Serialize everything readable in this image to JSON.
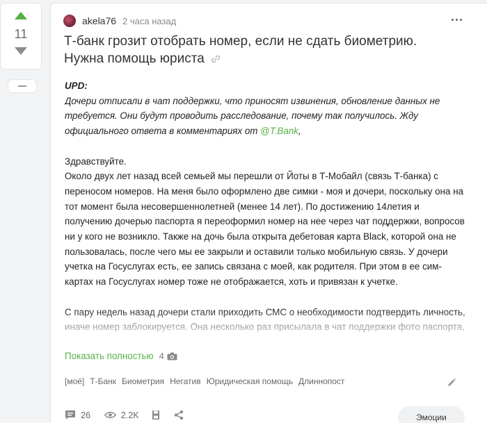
{
  "vote": {
    "count": "11"
  },
  "post": {
    "author": "akela76",
    "time": "2 часа назад",
    "title": "Т-банк грозит отобрать номер, если не сдать биометрию. Нужна помощь юриста",
    "upd_label": "UPD:",
    "upd_text": "Дочери отписали в чат поддержки, что приносят извинения, обновление данных не требуется. Они будут проводить расследование, почему так получилось. Жду официального ответа в комментариях от ",
    "upd_mention": "@T.Bank",
    "upd_tail": ",",
    "paragraph1_greeting": "Здравствуйте.",
    "paragraph1": "Около двух лет назад всей семьей мы перешли от Йоты в Т-Мобайл (связь Т-банка) с переносом номеров. На меня было оформлено две симки - моя и дочери, поскольку она на тот момент была несовершеннолетней (менее 14 лет). По достижению 14летия и получению дочерью паспорта я переоформил номер на нее через чат поддержки, вопросов ни у кого не возникло. Также на дочь была открыта дебетовая карта Black, которой она не пользовалась, после чего мы ее закрыли и оставили только мобильную связь. У дочери учетка на Госуслугах есть, ее запись связана с моей, как родителя. При этом в ее сим-картах на Госуслугах номер тоже не отображается, хоть и привязан к учетке.",
    "paragraph2": "С пару недель назад дочери стали приходить СМС о необходимости подтвердить личность, иначе номер заблокируется. Она несколько раз присылала в чат поддержки фото паспорта, но ситуация не менялась. И вот сегодня оператор поддержки прислал вот это:",
    "show_more": "Показать полностью",
    "image_count": "4",
    "tags": [
      "[моё]",
      "Т-Банк",
      "Биометрия",
      "Негатив",
      "Юридическая помощь",
      "Длиннопост"
    ],
    "comments": "26",
    "views": "2.2K",
    "emotions": "Эмоции"
  },
  "colors": {
    "accent": "#57b046",
    "background": "#f2f3f5"
  },
  "icons": [
    "arrow-up-icon",
    "arrow-down-icon",
    "minus-icon",
    "more-icon",
    "link-icon",
    "camera-icon",
    "edit-icon",
    "comment-icon",
    "eye-icon",
    "bookmark-icon",
    "share-icon"
  ]
}
